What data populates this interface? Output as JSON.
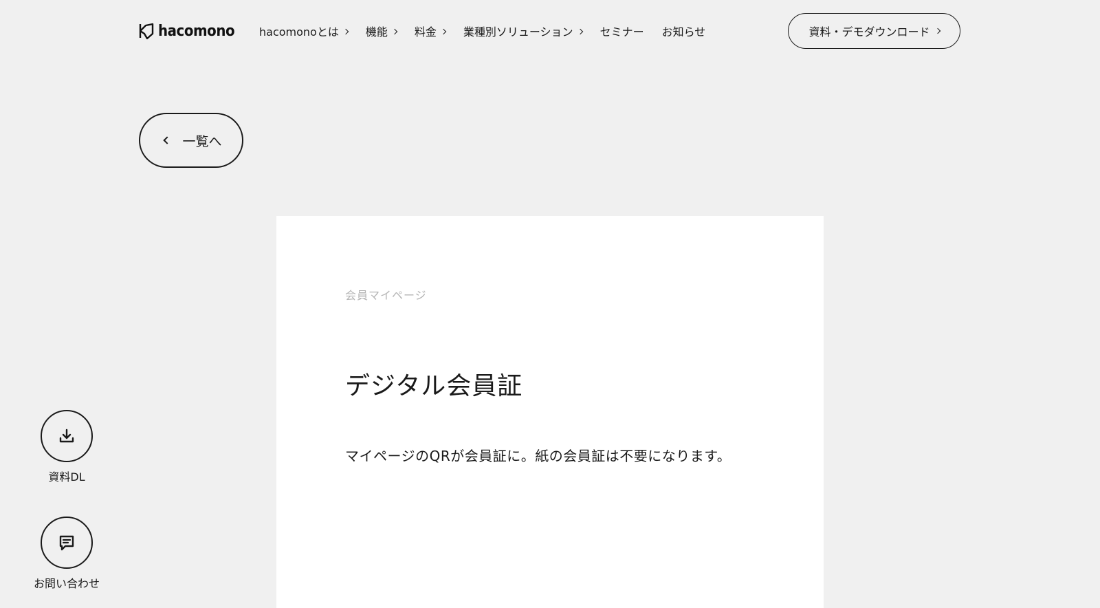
{
  "header": {
    "logo_text": "hacomono",
    "nav": [
      {
        "label": "hacomonoとは",
        "has_chevron": true,
        "icon": "chevron-right-icon"
      },
      {
        "label": "機能",
        "has_chevron": true,
        "icon": "chevron-right-icon"
      },
      {
        "label": "料金",
        "has_chevron": true,
        "icon": "chevron-right-icon"
      },
      {
        "label": "業種別ソリューション",
        "has_chevron": true,
        "icon": "chevron-right-icon"
      },
      {
        "label": "セミナー",
        "has_chevron": false
      },
      {
        "label": "お知らせ",
        "has_chevron": false
      }
    ],
    "cta_label": "資料・デモダウンロード",
    "cta_icon": "chevron-right-icon"
  },
  "back": {
    "label": "一覧へ",
    "icon": "chevron-left-icon"
  },
  "card": {
    "category": "会員マイページ",
    "title": "デジタル会員証",
    "description": "マイページのQRが会員証に。紙の会員証は不要になります。"
  },
  "floating": {
    "download": {
      "label": "資料DL",
      "icon": "download-icon"
    },
    "contact": {
      "label": "お問い合わせ",
      "icon": "chat-icon"
    }
  },
  "colors": {
    "background": "#f0f0f0",
    "card": "#ffffff",
    "text": "#1a1a1a",
    "muted": "#b5b5b5"
  }
}
